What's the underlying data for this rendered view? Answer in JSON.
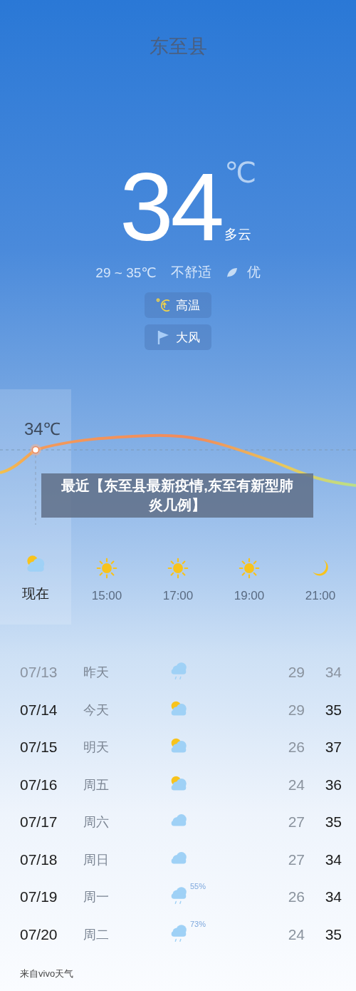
{
  "city": "东至县",
  "current": {
    "temp": "34",
    "unit": "℃",
    "condition": "多云",
    "range": "29 ~ 35℃",
    "comfort": "不舒适",
    "air_quality": "优"
  },
  "alerts": [
    {
      "kind": "heat",
      "label": "高温"
    },
    {
      "kind": "wind",
      "label": "大风"
    }
  ],
  "hourly": {
    "now_temp": "34℃",
    "items": [
      {
        "kind": "partly",
        "time": "现在",
        "selected": true
      },
      {
        "kind": "sun",
        "time": "15:00",
        "selected": false
      },
      {
        "kind": "sun",
        "time": "17:00",
        "selected": false
      },
      {
        "kind": "sun",
        "time": "19:00",
        "selected": false
      },
      {
        "kind": "moon",
        "time": "21:00",
        "selected": false
      }
    ]
  },
  "caption": "最近【东至县最新疫情,东至有新型肺炎几例】",
  "daily": [
    {
      "date": "07/13",
      "day": "昨天",
      "kind": "rain",
      "low": "29",
      "high": "34",
      "past": true
    },
    {
      "date": "07/14",
      "day": "今天",
      "kind": "partly",
      "low": "29",
      "high": "35",
      "past": false
    },
    {
      "date": "07/15",
      "day": "明天",
      "kind": "partly",
      "low": "26",
      "high": "37",
      "past": false
    },
    {
      "date": "07/16",
      "day": "周五",
      "kind": "partly",
      "low": "24",
      "high": "36",
      "past": false
    },
    {
      "date": "07/17",
      "day": "周六",
      "kind": "cloudy",
      "low": "27",
      "high": "35",
      "past": false
    },
    {
      "date": "07/18",
      "day": "周日",
      "kind": "cloudy",
      "low": "27",
      "high": "34",
      "past": false
    },
    {
      "date": "07/19",
      "day": "周一",
      "kind": "rain",
      "rain_chance": "55%",
      "low": "26",
      "high": "34",
      "past": false
    },
    {
      "date": "07/20",
      "day": "周二",
      "kind": "rain",
      "rain_chance": "73%",
      "low": "24",
      "high": "35",
      "past": false
    }
  ],
  "footer": "来自vivo天气"
}
